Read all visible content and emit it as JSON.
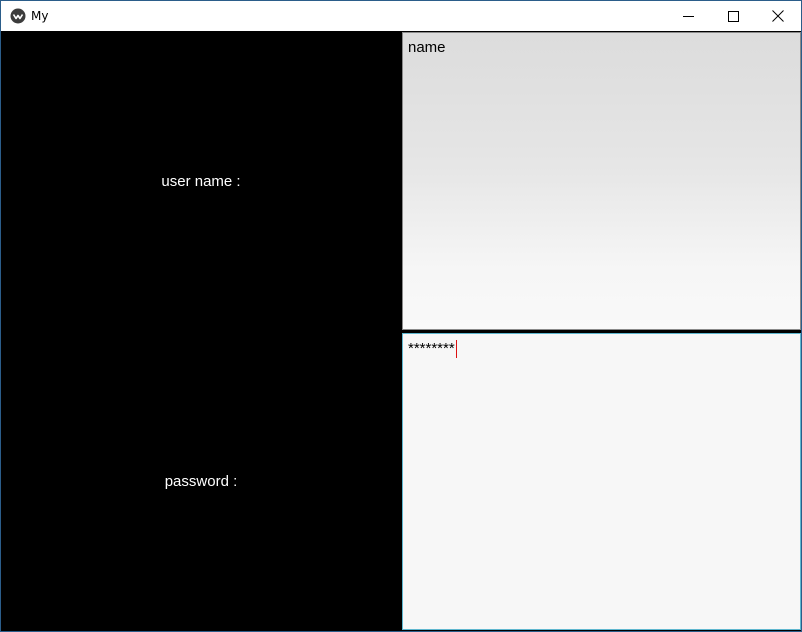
{
  "window": {
    "title": "My"
  },
  "form": {
    "username_label": "user name :",
    "password_label": "password :",
    "username_value": "name",
    "password_value": "********"
  },
  "icons": {
    "app": "app-icon",
    "minimize": "minimize-icon",
    "maximize": "maximize-icon",
    "close": "close-icon"
  },
  "colors": {
    "background": "#000000",
    "label_text": "#ffffff",
    "focus_border": "#5fb7cf",
    "caret": "#dd1111"
  }
}
